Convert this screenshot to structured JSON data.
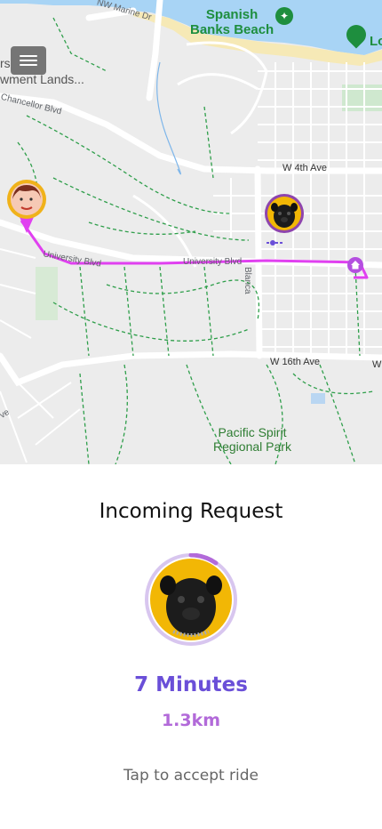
{
  "map": {
    "labels": {
      "marine_drive": "NW Marine Dr",
      "spanish_banks": "Spanish\nBanks Beach",
      "edge_poi": "Lo",
      "endowment_lands": "rs\nwment Lands...",
      "chancellor_blvd": "Chancellor Blvd",
      "w4th": "W 4th Ave",
      "university_blvd_1": "University Blvd",
      "university_blvd_2": "University Blvd",
      "blanca": "Blanca",
      "w16th": "W 16th Ave",
      "w_edge": "W",
      "ave_edge": "ve",
      "pacific_spirit": "Pacific Spirit\nRegional Park"
    },
    "colors": {
      "route": "#e040f0",
      "park_path": "#2e9e4a",
      "water": "#a8d4f5",
      "road": "#ffffff"
    }
  },
  "menu": {
    "icon": "hamburger-menu-icon"
  },
  "request": {
    "title": "Incoming Request",
    "minutes": "7 Minutes",
    "distance": "1.3km",
    "hint": "Tap to accept ride",
    "accent": "#6a4fd8",
    "accent_light": "#b26ad9"
  }
}
